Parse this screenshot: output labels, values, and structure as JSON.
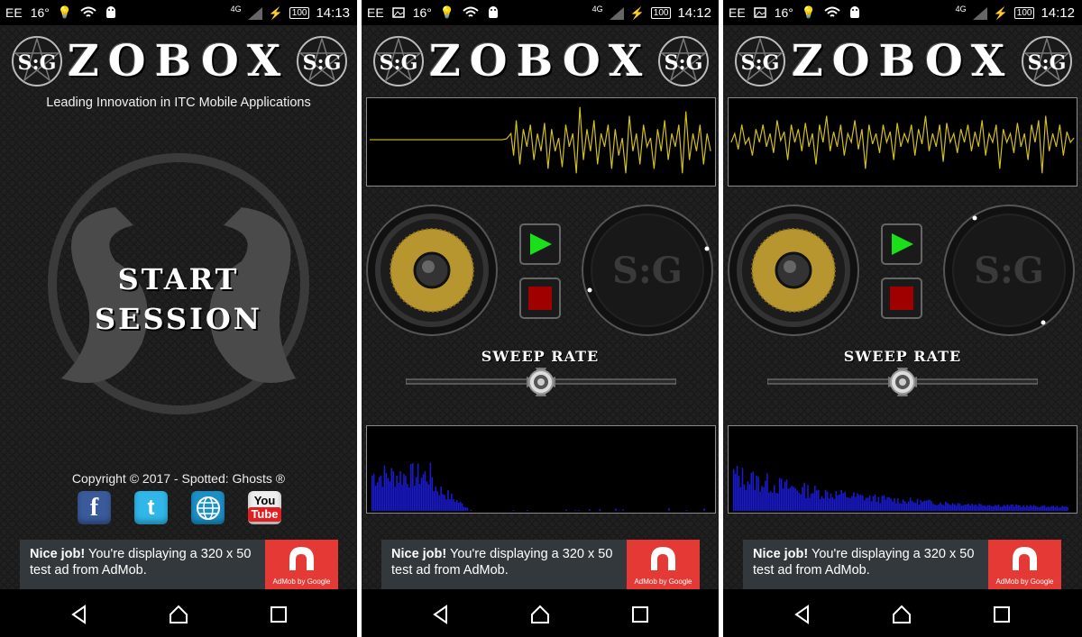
{
  "screens": [
    {
      "status": {
        "carrier": "EE",
        "temp": "16°",
        "network": "4G",
        "battery": "100",
        "time": "14:13"
      },
      "app_title": "ZOBOX",
      "badge_text": "S:G",
      "tagline": "Leading Innovation in ITC Mobile Applications",
      "start_line1": "START",
      "start_line2": "SESSION",
      "copyright": "Copyright © 2017 - Spotted: Ghosts ®",
      "social": {
        "facebook": "f",
        "twitter": "t",
        "youtube_1": "You",
        "youtube_2": "Tube"
      },
      "ad": {
        "bold": "Nice job!",
        "text": " You're displaying a 320 x 50 test ad from AdMob.",
        "badge": "AdMob by Google"
      }
    },
    {
      "status": {
        "carrier": "EE",
        "temp": "16°",
        "network": "4G",
        "battery": "100",
        "time": "14:12"
      },
      "app_title": "ZOBOX",
      "badge_text": "S:G",
      "sweep_label": "SWEEP RATE",
      "sweep_rate": 0.5,
      "ad": {
        "bold": "Nice job!",
        "text": " You're displaying a 320 x 50 test ad from AdMob.",
        "badge": "AdMob by Google"
      }
    },
    {
      "status": {
        "carrier": "EE",
        "temp": "16°",
        "network": "4G",
        "battery": "100",
        "time": "14:12"
      },
      "app_title": "ZOBOX",
      "badge_text": "S:G",
      "sweep_label": "SWEEP RATE",
      "sweep_rate": 0.5,
      "ad": {
        "bold": "Nice job!",
        "text": " You're displaying a 320 x 50 test ad from AdMob.",
        "badge": "AdMob by Google"
      }
    }
  ],
  "colors": {
    "waveform": "#d4c21a",
    "spectrum": "#1a1ad0",
    "play": "#19e019",
    "stop": "#a00000",
    "ad_red": "#e53935"
  }
}
